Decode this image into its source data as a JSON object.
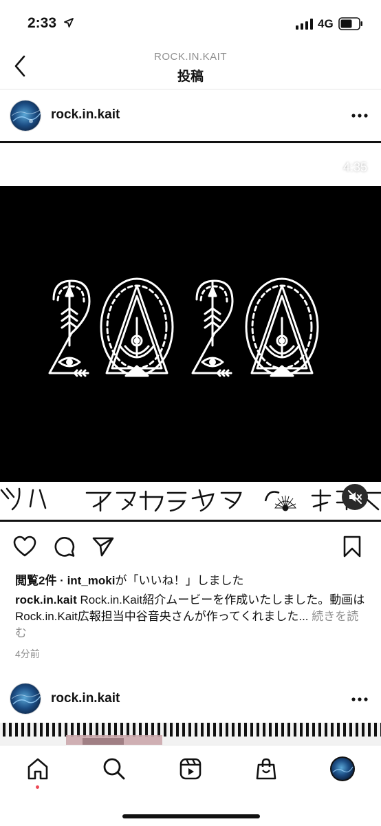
{
  "status_bar": {
    "time": "2:33",
    "network": "4G"
  },
  "header": {
    "account": "ROCK.IN.KAIT",
    "title": "投稿"
  },
  "post": {
    "username": "rock.in.kait",
    "video_time": "4:35",
    "likes_prefix": "閲覧2件 · ",
    "likes_user": "int_moki",
    "likes_suffix": "が「いいね！」しました",
    "caption_user": "rock.in.kait",
    "caption_text": " Rock.in.Kait紹介ムービーを作成いたしました。動画はRock.in.Kait広報担当中谷音央さんが作ってくれました... ",
    "caption_more": "続きを読む",
    "time_ago": "4分前"
  },
  "next_post": {
    "username": "rock.in.kait"
  },
  "icons": {
    "back": "chevron-left-icon",
    "more": "more-horizontal-icon",
    "like": "heart-icon",
    "comment": "comment-icon",
    "share": "send-icon",
    "save": "bookmark-icon",
    "mute": "speaker-muted-icon",
    "home": "home-icon",
    "search": "search-icon",
    "reels": "reels-icon",
    "shop": "shopping-bag-icon",
    "profile": "profile-avatar"
  },
  "colors": {
    "accent": "#ed4956",
    "text": "#111111",
    "muted": "#8e8e8e",
    "video_bg": "#000000"
  }
}
